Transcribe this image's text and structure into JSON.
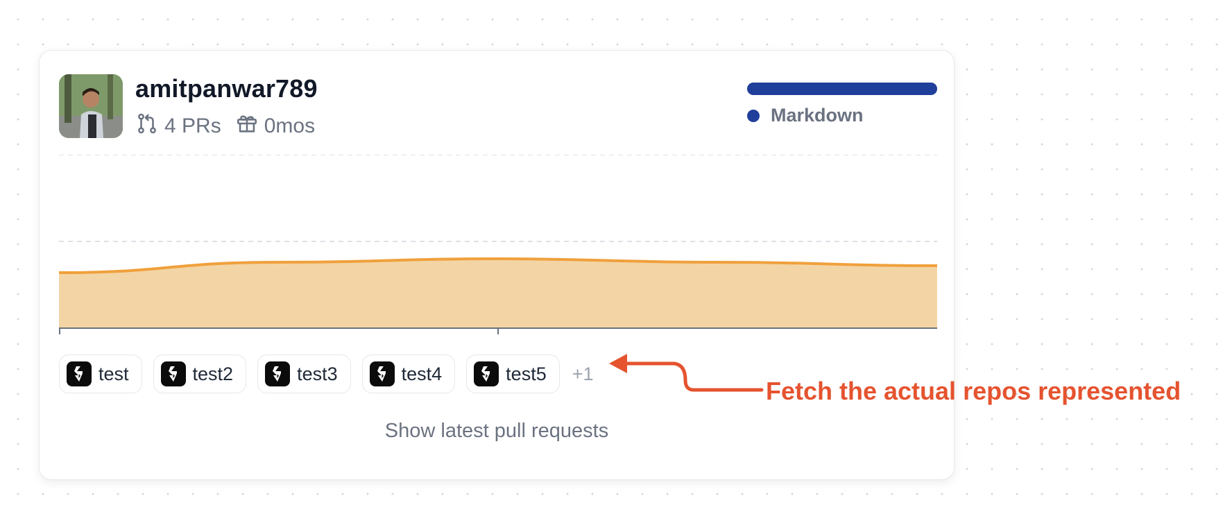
{
  "profile": {
    "username": "amitpanwar789",
    "prs": "4 PRs",
    "age": "0mos"
  },
  "languages": [
    {
      "name": "Markdown",
      "color": "#203f9a",
      "share": 1.0
    }
  ],
  "chart_data": {
    "type": "area",
    "x": [
      0,
      1,
      2,
      3,
      4
    ],
    "series": [
      {
        "values": [
          3.2,
          3.8,
          4.0,
          3.8,
          3.6
        ],
        "color": "#f0a03c",
        "fill": "#f3d5a5"
      }
    ],
    "ylim": [
      0,
      10
    ],
    "grid": true
  },
  "repos": [
    {
      "label": "test"
    },
    {
      "label": "test2"
    },
    {
      "label": "test3"
    },
    {
      "label": "test4"
    },
    {
      "label": "test5"
    }
  ],
  "more_repos": "+1",
  "show_latest": "Show latest pull requests",
  "annotation": {
    "text": "Fetch the actual repos represented",
    "color": "#e5532f"
  }
}
